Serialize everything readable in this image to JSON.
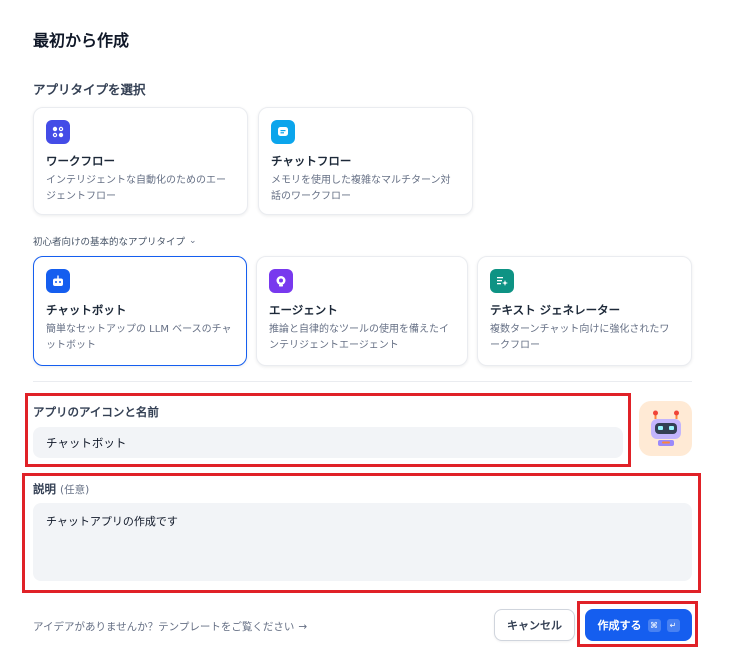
{
  "title": "最初から作成",
  "app_type_label": "アプリタイプを選択",
  "advanced_types": [
    {
      "name": "ワークフロー",
      "desc": "インテリジェントな自動化のためのエージェントフロー",
      "icon": "workflow-icon",
      "color": "#444ce7"
    },
    {
      "name": "チャットフロー",
      "desc": "メモリを使用した複雑なマルチターン対話のワークフロー",
      "icon": "chatflow-icon",
      "color": "#0ba5ec"
    }
  ],
  "beginner_label": "初心者向けの基本的なアプリタイプ",
  "beginner_types": [
    {
      "name": "チャットボット",
      "desc": "簡単なセットアップの LLM ベースのチャットボット",
      "icon": "chatbot-icon",
      "color": "#155eef"
    },
    {
      "name": "エージェント",
      "desc": "推論と自律的なツールの使用を備えたインテリジェントエージェント",
      "icon": "agent-icon",
      "color": "#7839ee"
    },
    {
      "name": "テキスト ジェネレーター",
      "desc": "複数ターンチャット向けに強化されたワークフロー",
      "icon": "text-generator-icon",
      "color": "#0e9384"
    }
  ],
  "name_field": {
    "label": "アプリのアイコンと名前",
    "value": "チャットボット"
  },
  "desc_field": {
    "label": "説明",
    "optional": "(任意)",
    "value": "チャットアプリの作成です"
  },
  "hint": "アイデアがありませんか？テンプレートをご覧ください",
  "hint_arrow": "→",
  "buttons": {
    "cancel": "キャンセル",
    "create": "作成する",
    "cmd": "⌘",
    "enter": "↵"
  },
  "colors": {
    "accent": "#155eef",
    "highlight": "#e02127"
  }
}
